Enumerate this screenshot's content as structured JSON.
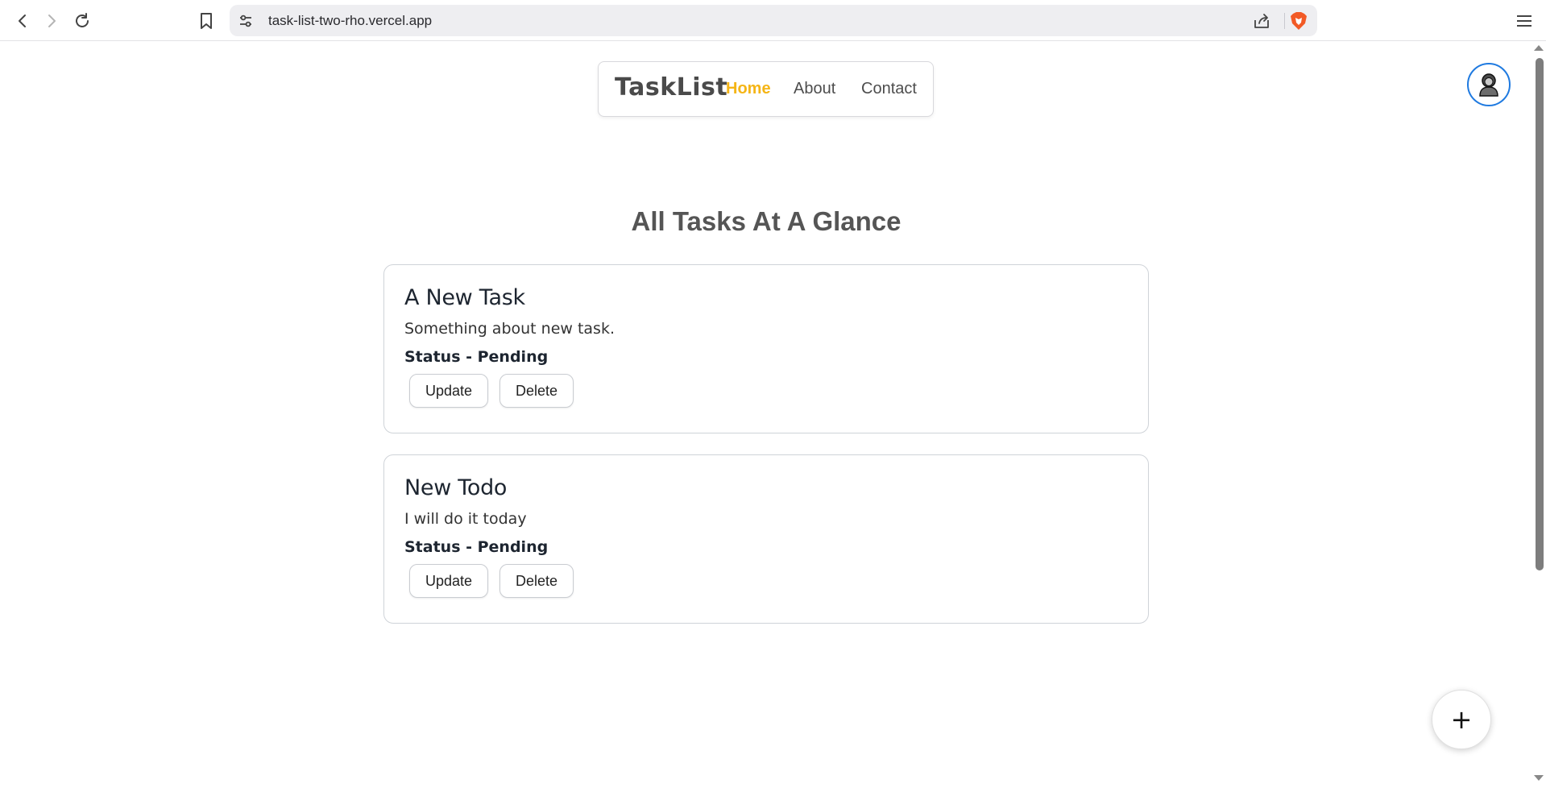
{
  "browser": {
    "url": "task-list-two-rho.vercel.app"
  },
  "nav": {
    "brand": "TaskList",
    "links": [
      {
        "label": "Home",
        "active": true
      },
      {
        "label": "About",
        "active": false
      },
      {
        "label": "Contact",
        "active": false
      }
    ]
  },
  "main": {
    "title": "All Tasks At A Glance",
    "tasks": [
      {
        "title": "A New Task",
        "description": "Something about new task.",
        "status": "Status - Pending",
        "update_label": "Update",
        "delete_label": "Delete"
      },
      {
        "title": "New Todo",
        "description": "I will do it today",
        "status": "Status - Pending",
        "update_label": "Update",
        "delete_label": "Delete"
      }
    ]
  },
  "fab": {
    "label": "+"
  },
  "colors": {
    "accent": "#f5b516",
    "avatar_ring": "#1f7ae0",
    "brave": "#f25a26"
  },
  "icons": {
    "back": "chevron-left-icon",
    "forward": "chevron-right-icon",
    "reload": "reload-icon",
    "bookmark": "bookmark-icon",
    "site_settings": "tune-icon",
    "share": "share-icon",
    "brave": "brave-lion-icon",
    "menu": "hamburger-menu-icon",
    "avatar": "user-avatar-icon"
  }
}
